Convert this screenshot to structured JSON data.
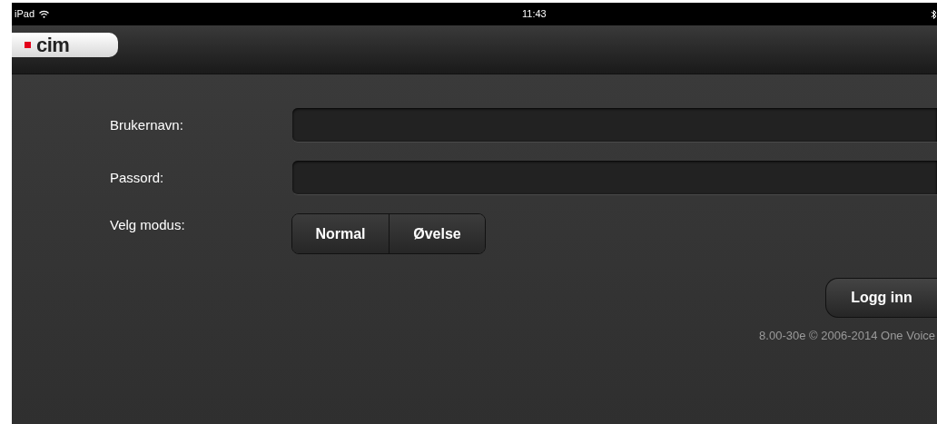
{
  "status_bar": {
    "carrier": "iPad",
    "time": "11:43"
  },
  "header": {
    "logo": "cim"
  },
  "form": {
    "fields": [
      {
        "label": "Brukernavn:"
      },
      {
        "label": "Passord:"
      }
    ],
    "mode": {
      "label": "Velg modus:",
      "options": [
        {
          "label": "Normal",
          "selected": false
        },
        {
          "label": "Øvelse",
          "selected": false
        }
      ]
    },
    "submit": "Logg inn"
  },
  "footer": "8.00-30e © 2006-2014 One Voice"
}
